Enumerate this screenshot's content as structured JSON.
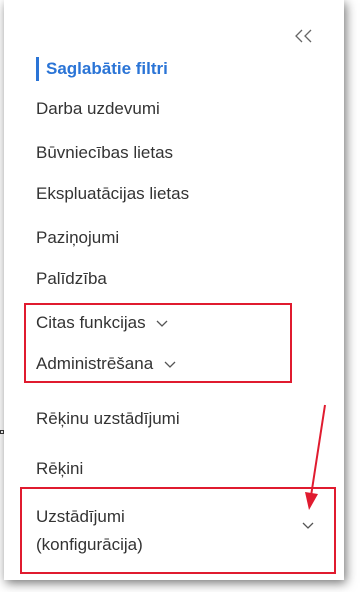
{
  "sidebar": {
    "items": [
      {
        "label": "Saglabātie filtri",
        "active": true
      },
      {
        "label": "Darba uzdevumi"
      },
      {
        "label": "Būvniecības lietas"
      },
      {
        "label": "Ekspluatācijas lietas"
      },
      {
        "label": "Paziņojumi"
      },
      {
        "label": "Palīdzība"
      },
      {
        "label": "Citas funkcijas"
      },
      {
        "label": "Administrēšana"
      },
      {
        "label": "Rēķinu uzstādījumi"
      },
      {
        "label": "Rēķini"
      },
      {
        "label_line1": "Uzstādījumi",
        "label_line2": "(konfigurācija)"
      }
    ]
  },
  "icons": {
    "collapse": "double-chevron-left-icon",
    "submenu": "chevron-down-icon"
  },
  "colors": {
    "active": "#2a74d6",
    "annotation": "#e01b2f"
  }
}
